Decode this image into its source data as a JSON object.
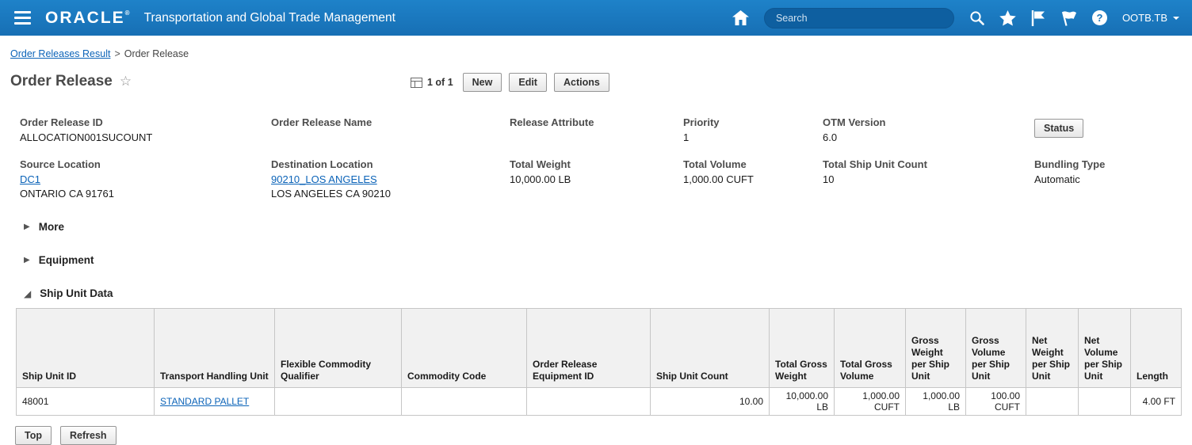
{
  "header": {
    "brand": "ORACLE",
    "brand_mark": "®",
    "app_title": "Transportation and Global Trade Management",
    "search_placeholder": "Search",
    "user_menu": "OOTB.TB"
  },
  "breadcrumb": {
    "parent": "Order Releases Result",
    "separator": ">",
    "current": "Order Release"
  },
  "page_title": "Order Release",
  "toolbar": {
    "pager": "1 of 1",
    "new_label": "New",
    "edit_label": "Edit",
    "actions_label": "Actions",
    "status_label": "Status"
  },
  "fields": {
    "order_release_id": {
      "label": "Order Release ID",
      "value": "ALLOCATION001SUCOUNT"
    },
    "order_release_name": {
      "label": "Order Release Name",
      "value": ""
    },
    "release_attribute": {
      "label": "Release Attribute",
      "value": ""
    },
    "priority": {
      "label": "Priority",
      "value": "1"
    },
    "otm_version": {
      "label": "OTM Version",
      "value": "6.0"
    },
    "source_location": {
      "label": "Source Location",
      "link": "DC1",
      "address": "ONTARIO CA 91761"
    },
    "destination_location": {
      "label": "Destination Location",
      "link": "90210_LOS ANGELES",
      "address": "LOS ANGELES CA 90210"
    },
    "total_weight": {
      "label": "Total Weight",
      "value": "10,000.00 LB"
    },
    "total_volume": {
      "label": "Total Volume",
      "value": "1,000.00 CUFT"
    },
    "total_ship_unit_count": {
      "label": "Total Ship Unit Count",
      "value": "10"
    },
    "bundling_type": {
      "label": "Bundling Type",
      "value": "Automatic"
    }
  },
  "sections": {
    "more": "More",
    "equipment": "Equipment",
    "ship_unit_data": "Ship Unit Data"
  },
  "table": {
    "columns": [
      "Ship Unit ID",
      "Transport Handling Unit",
      "Flexible Commodity Qualifier",
      "Commodity Code",
      "Order Release Equipment ID",
      "Ship Unit Count",
      "Total Gross Weight",
      "Total Gross Volume",
      "Gross Weight per Ship Unit",
      "Gross Volume per Ship Unit",
      "Net Weight per Ship Unit",
      "Net Volume per Ship Unit",
      "Length"
    ],
    "row": {
      "ship_unit_id": "48001",
      "transport_handling_unit": "STANDARD PALLET",
      "flexible_commodity_qualifier": "",
      "commodity_code": "",
      "order_release_equipment_id": "",
      "ship_unit_count": "10.00",
      "total_gross_weight": "10,000.00 LB",
      "total_gross_volume": "1,000.00 CUFT",
      "gross_weight_per_ship_unit": "1,000.00 LB",
      "gross_volume_per_ship_unit": "100.00 CUFT",
      "net_weight_per_ship_unit": "",
      "net_volume_per_ship_unit": "",
      "length": "4.00 FT"
    }
  },
  "footer": {
    "top_label": "Top",
    "refresh_label": "Refresh"
  }
}
